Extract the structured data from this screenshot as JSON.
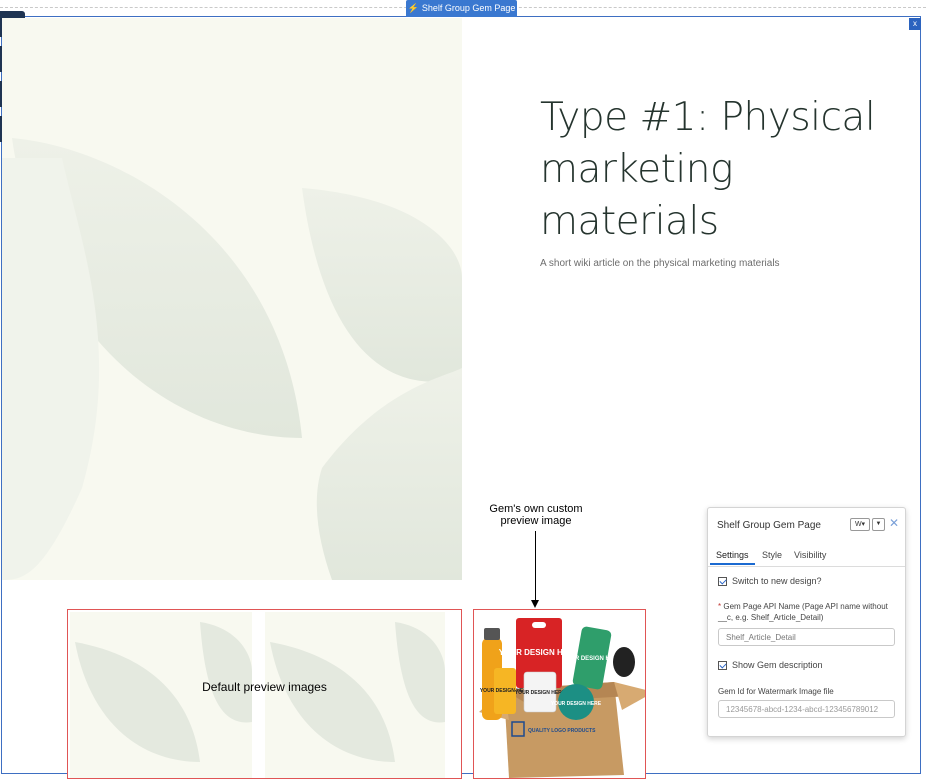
{
  "app": {
    "tab_label": "Shelf Group Gem Page",
    "close_label": "x"
  },
  "toolbar": {
    "items": [
      {
        "icon": "lightning-icon",
        "glyph": "⚡"
      },
      {
        "icon": "paintbrush-icon",
        "glyph": "✎"
      },
      {
        "icon": "list-icon",
        "glyph": "≡"
      },
      {
        "icon": "gear-icon",
        "glyph": "⚙"
      }
    ]
  },
  "hero": {
    "title_lines": [
      "Type #1: Physical",
      "marketing",
      "materials"
    ],
    "subtitle": "A short wiki article on the physical marketing materials"
  },
  "annotations": {
    "custom_preview_line1": "Gem's own custom",
    "custom_preview_line2": "preview image",
    "default_preview": "Default preview images"
  },
  "product_art": {
    "design_text_1": "YOUR DESIGN HERE",
    "design_text_2": "YOUR DESIGN HERE",
    "design_text_3": "YOUR DESIGN HERE",
    "design_text_4": "YOUR DESIGN HERE",
    "design_text_5": "YOUR DESIGN HERE",
    "box_text": "QUALITY LOGO PRODUCTS"
  },
  "panel": {
    "title": "Shelf Group Gem Page",
    "badge": "W",
    "tabs": [
      "Settings",
      "Style",
      "Visibility"
    ],
    "switch_design_label": "Switch to new design?",
    "api_name_label": "Gem Page API Name (Page API name without __c, e.g. Shelf_Article_Detail)",
    "api_name_value": "Shelf_Article_Detail",
    "show_desc_label": "Show Gem description",
    "watermark_label": "Gem Id for Watermark Image file",
    "watermark_placeholder": "12345678-abcd-1234-abcd-123456789012"
  },
  "colors": {
    "accent_blue": "#3a78d0",
    "toolbar_bg": "#1f3452",
    "hero_bg": "#f8f9f0",
    "leaf_color": "#e4e9df",
    "annotation_red": "#e05555"
  }
}
